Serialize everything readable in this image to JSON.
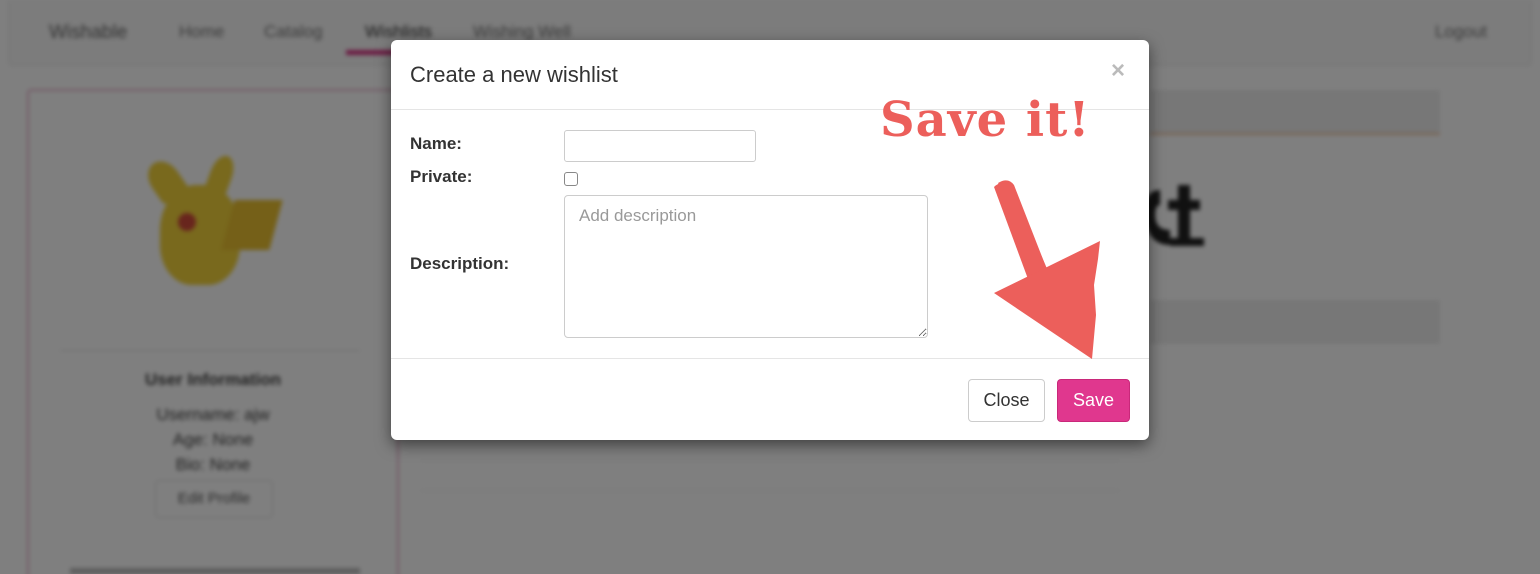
{
  "background": {
    "nav": {
      "brand": "Wishable",
      "items": [
        "Home",
        "Catalog",
        "Wishlists",
        "Wishing Well"
      ],
      "right_link": "Logout"
    },
    "profile": {
      "heading": "User Information",
      "username": "Username: ajw",
      "age": "Age: None",
      "bio": "Bio: None",
      "edit_label": "Edit Profile"
    }
  },
  "modal": {
    "title": "Create a new wishlist",
    "close_icon": "×",
    "fields": {
      "name_label": "Name:",
      "name_value": "",
      "private_label": "Private:",
      "private_checked": false,
      "description_label": "Description:",
      "description_placeholder": "Add description",
      "description_value": ""
    },
    "buttons": {
      "close_label": "Close",
      "save_label": "Save"
    }
  },
  "annotation": {
    "text": "Save it!",
    "color": "#ec5f5b",
    "icon": "arrow-down-right-icon"
  },
  "colors": {
    "accent": "#e0378e",
    "annotation": "#ec5f5b"
  }
}
